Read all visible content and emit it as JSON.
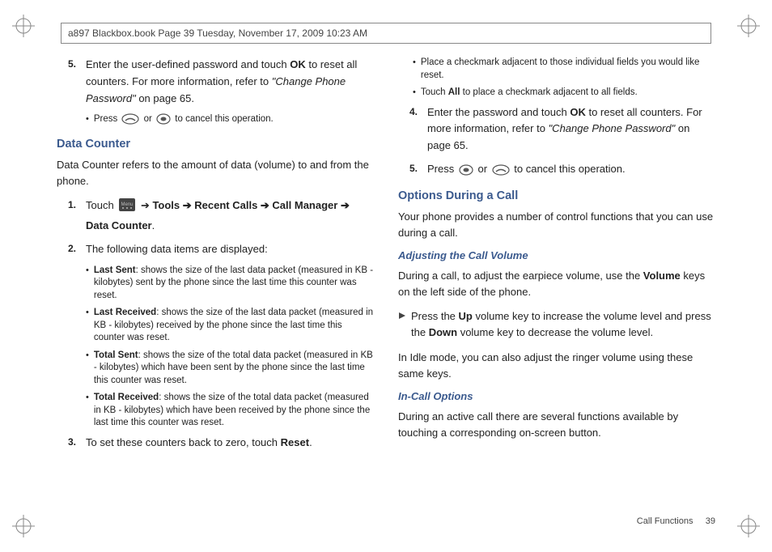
{
  "header": "a897 Blackbox.book  Page 39  Tuesday, November 17, 2009  10:23 AM",
  "left": {
    "step5": "Enter the user-defined password and touch ",
    "step5b": " to reset all counters. For more information, refer to ",
    "step5ref": "\"Change Phone Password\"",
    "step5c": "  on page 65.",
    "ok": "OK",
    "cancel": "Press ",
    "cancel2": " or ",
    "cancel3": " to cancel this operation.",
    "dc_heading": "Data Counter",
    "dc_para": "Data Counter refers to the amount of data (volume) to and from the phone.",
    "s1a": "Touch ",
    "s1b": " ➔ Recent Calls ➔ Call Manager ➔ Data Counter",
    "tools": "Tools",
    "s2": "The following data items are displayed:",
    "b1h": "Last Sent",
    "b1": ": shows the size of the last data packet (measured in KB - kilobytes) sent by the phone since the last time this counter was reset.",
    "b2h": "Last Received",
    "b2": ": shows the size of the last data packet (measured in KB - kilobytes) received by the phone since the last time this counter was reset.",
    "b3h": "Total Sent",
    "b3": ": shows the size of the total data packet (measured in KB - kilobytes) which have been sent by the phone since the last time this counter was reset.",
    "b4h": "Total Received",
    "b4": ": shows the size of the total data packet (measured in KB - kilobytes) which have been received by the phone since the last time this counter was reset.",
    "s3a": "To set these counters back to zero, touch ",
    "s3b": "Reset",
    "s3c": "."
  },
  "right": {
    "b1": "Place a checkmark adjacent to those individual fields you would like reset.",
    "b2a": "Touch ",
    "b2b": "All",
    "b2c": " to place a checkmark adjacent to all fields.",
    "s4a": "Enter the password and touch ",
    "s4ok": "OK",
    "s4b": " to reset all counters. For more information, refer to ",
    "s4ref": "\"Change Phone Password\"",
    "s4c": "  on page 65.",
    "s5a": "Press ",
    "s5b": " or ",
    "s5c": " to cancel this operation.",
    "opt_heading": "Options During a Call",
    "opt_para": "Your phone provides a number of control functions that you can use during a call.",
    "vol_heading": "Adjusting the Call Volume",
    "vol_para": "During a call, to adjust the earpiece volume, use the ",
    "vol_volume": "Volume",
    "vol_para2": " keys on the left side of the phone.",
    "vol_up_a": "Press the ",
    "vol_up_b": "Up",
    "vol_up_c": " volume key to increase the volume level and press the ",
    "vol_down": "Down",
    "vol_up_d": " volume key to decrease the volume level.",
    "idle": "In Idle mode, you can also adjust the ringer volume using these same keys.",
    "incall_heading": "In-Call Options",
    "incall_para": "During an active call there are several functions available by touching a corresponding on-screen button."
  },
  "footer": {
    "section": "Call Functions",
    "page": "39"
  }
}
